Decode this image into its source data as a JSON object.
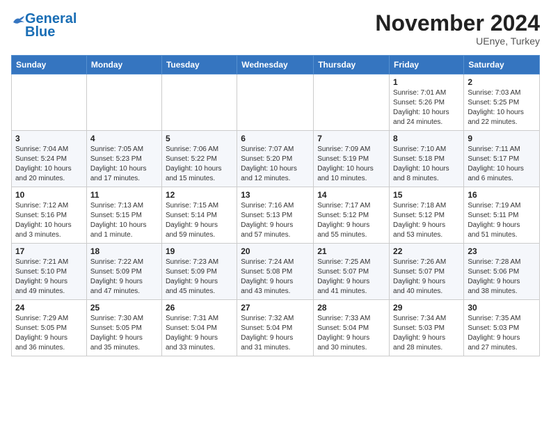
{
  "logo": {
    "general": "General",
    "blue": "Blue"
  },
  "title": "November 2024",
  "location": "UEnye, Turkey",
  "weekdays": [
    "Sunday",
    "Monday",
    "Tuesday",
    "Wednesday",
    "Thursday",
    "Friday",
    "Saturday"
  ],
  "weeks": [
    [
      {
        "day": "",
        "info": ""
      },
      {
        "day": "",
        "info": ""
      },
      {
        "day": "",
        "info": ""
      },
      {
        "day": "",
        "info": ""
      },
      {
        "day": "",
        "info": ""
      },
      {
        "day": "1",
        "info": "Sunrise: 7:01 AM\nSunset: 5:26 PM\nDaylight: 10 hours\nand 24 minutes."
      },
      {
        "day": "2",
        "info": "Sunrise: 7:03 AM\nSunset: 5:25 PM\nDaylight: 10 hours\nand 22 minutes."
      }
    ],
    [
      {
        "day": "3",
        "info": "Sunrise: 7:04 AM\nSunset: 5:24 PM\nDaylight: 10 hours\nand 20 minutes."
      },
      {
        "day": "4",
        "info": "Sunrise: 7:05 AM\nSunset: 5:23 PM\nDaylight: 10 hours\nand 17 minutes."
      },
      {
        "day": "5",
        "info": "Sunrise: 7:06 AM\nSunset: 5:22 PM\nDaylight: 10 hours\nand 15 minutes."
      },
      {
        "day": "6",
        "info": "Sunrise: 7:07 AM\nSunset: 5:20 PM\nDaylight: 10 hours\nand 12 minutes."
      },
      {
        "day": "7",
        "info": "Sunrise: 7:09 AM\nSunset: 5:19 PM\nDaylight: 10 hours\nand 10 minutes."
      },
      {
        "day": "8",
        "info": "Sunrise: 7:10 AM\nSunset: 5:18 PM\nDaylight: 10 hours\nand 8 minutes."
      },
      {
        "day": "9",
        "info": "Sunrise: 7:11 AM\nSunset: 5:17 PM\nDaylight: 10 hours\nand 6 minutes."
      }
    ],
    [
      {
        "day": "10",
        "info": "Sunrise: 7:12 AM\nSunset: 5:16 PM\nDaylight: 10 hours\nand 3 minutes."
      },
      {
        "day": "11",
        "info": "Sunrise: 7:13 AM\nSunset: 5:15 PM\nDaylight: 10 hours\nand 1 minute."
      },
      {
        "day": "12",
        "info": "Sunrise: 7:15 AM\nSunset: 5:14 PM\nDaylight: 9 hours\nand 59 minutes."
      },
      {
        "day": "13",
        "info": "Sunrise: 7:16 AM\nSunset: 5:13 PM\nDaylight: 9 hours\nand 57 minutes."
      },
      {
        "day": "14",
        "info": "Sunrise: 7:17 AM\nSunset: 5:12 PM\nDaylight: 9 hours\nand 55 minutes."
      },
      {
        "day": "15",
        "info": "Sunrise: 7:18 AM\nSunset: 5:12 PM\nDaylight: 9 hours\nand 53 minutes."
      },
      {
        "day": "16",
        "info": "Sunrise: 7:19 AM\nSunset: 5:11 PM\nDaylight: 9 hours\nand 51 minutes."
      }
    ],
    [
      {
        "day": "17",
        "info": "Sunrise: 7:21 AM\nSunset: 5:10 PM\nDaylight: 9 hours\nand 49 minutes."
      },
      {
        "day": "18",
        "info": "Sunrise: 7:22 AM\nSunset: 5:09 PM\nDaylight: 9 hours\nand 47 minutes."
      },
      {
        "day": "19",
        "info": "Sunrise: 7:23 AM\nSunset: 5:09 PM\nDaylight: 9 hours\nand 45 minutes."
      },
      {
        "day": "20",
        "info": "Sunrise: 7:24 AM\nSunset: 5:08 PM\nDaylight: 9 hours\nand 43 minutes."
      },
      {
        "day": "21",
        "info": "Sunrise: 7:25 AM\nSunset: 5:07 PM\nDaylight: 9 hours\nand 41 minutes."
      },
      {
        "day": "22",
        "info": "Sunrise: 7:26 AM\nSunset: 5:07 PM\nDaylight: 9 hours\nand 40 minutes."
      },
      {
        "day": "23",
        "info": "Sunrise: 7:28 AM\nSunset: 5:06 PM\nDaylight: 9 hours\nand 38 minutes."
      }
    ],
    [
      {
        "day": "24",
        "info": "Sunrise: 7:29 AM\nSunset: 5:05 PM\nDaylight: 9 hours\nand 36 minutes."
      },
      {
        "day": "25",
        "info": "Sunrise: 7:30 AM\nSunset: 5:05 PM\nDaylight: 9 hours\nand 35 minutes."
      },
      {
        "day": "26",
        "info": "Sunrise: 7:31 AM\nSunset: 5:04 PM\nDaylight: 9 hours\nand 33 minutes."
      },
      {
        "day": "27",
        "info": "Sunrise: 7:32 AM\nSunset: 5:04 PM\nDaylight: 9 hours\nand 31 minutes."
      },
      {
        "day": "28",
        "info": "Sunrise: 7:33 AM\nSunset: 5:04 PM\nDaylight: 9 hours\nand 30 minutes."
      },
      {
        "day": "29",
        "info": "Sunrise: 7:34 AM\nSunset: 5:03 PM\nDaylight: 9 hours\nand 28 minutes."
      },
      {
        "day": "30",
        "info": "Sunrise: 7:35 AM\nSunset: 5:03 PM\nDaylight: 9 hours\nand 27 minutes."
      }
    ]
  ]
}
